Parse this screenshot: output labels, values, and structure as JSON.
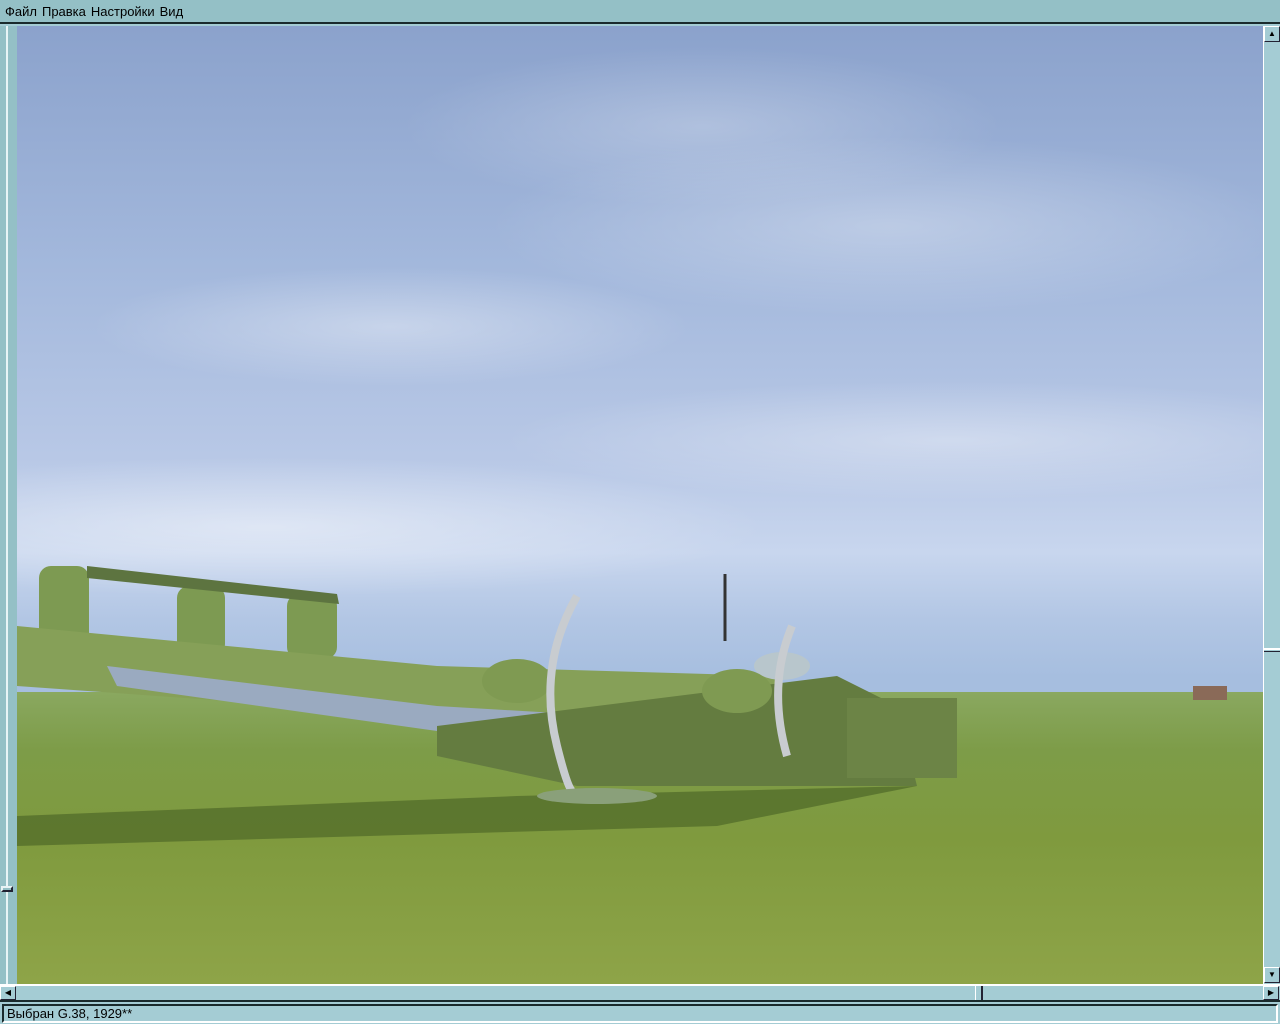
{
  "menu": {
    "items": [
      "Файл",
      "Правка",
      "Настройки",
      "Вид"
    ]
  },
  "status": {
    "text": "Выбран G.38, 1929**"
  },
  "scene": {
    "description_icon": "aircraft-3d-view",
    "sky_color": "#a3b8dc",
    "ground_color": "#7f9a3e"
  }
}
